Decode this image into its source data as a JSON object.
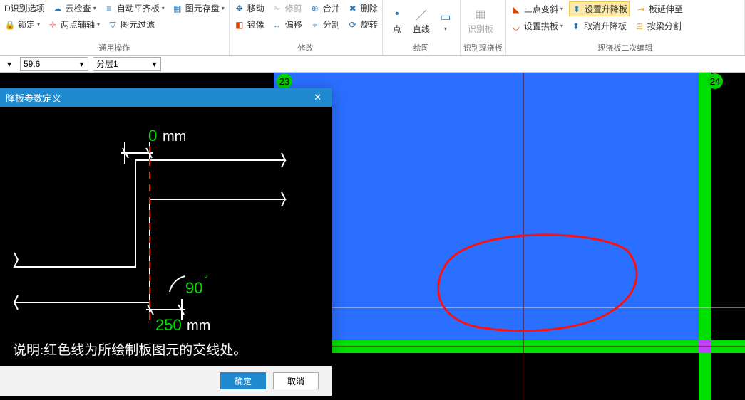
{
  "ribbon": {
    "groups": [
      {
        "label": "通用操作",
        "items_row1": [
          {
            "label": "D识别选项",
            "icon": "⚙"
          },
          {
            "label": "云检查",
            "icon": "☁"
          },
          {
            "label": "自动平齐板",
            "icon": "≡"
          },
          {
            "label": "图元存盘",
            "icon": "💾"
          }
        ],
        "items_row2": [
          {
            "label": "锁定",
            "icon": "🔒"
          },
          {
            "label": "两点辅轴",
            "icon": "✛"
          },
          {
            "label": "图元过滤",
            "icon": "▽"
          }
        ]
      },
      {
        "label": "修改",
        "items_row1": [
          {
            "label": "移动",
            "icon": "✥"
          },
          {
            "label": "修剪",
            "icon": "✁"
          },
          {
            "label": "合并",
            "icon": "⊕"
          },
          {
            "label": "删除",
            "icon": "✖"
          }
        ],
        "items_row2": [
          {
            "label": "镜像",
            "icon": "◧"
          },
          {
            "label": "偏移",
            "icon": "↔"
          },
          {
            "label": "分割",
            "icon": "÷"
          },
          {
            "label": "旋转",
            "icon": "⟳"
          }
        ]
      },
      {
        "label": "绘图",
        "big_items": [
          {
            "label": "点",
            "icon": "•"
          },
          {
            "label": "直线",
            "icon": "／"
          },
          {
            "label": "",
            "icon": "▭"
          }
        ]
      },
      {
        "label": "识别现浇板",
        "big_items": [
          {
            "label": "识别板",
            "icon": "▦"
          }
        ]
      },
      {
        "label": "现浇板二次编辑",
        "items_row1": [
          {
            "label": "三点变斜",
            "icon": "◣"
          },
          {
            "label": "设置升降板",
            "icon": "⬍",
            "hl": true
          },
          {
            "label": "板延伸至",
            "icon": "⇥"
          }
        ],
        "items_row2": [
          {
            "label": "设置拱板",
            "icon": "◡"
          },
          {
            "label": "取消升降板",
            "icon": "⬍"
          },
          {
            "label": "按梁分割",
            "icon": "⊟"
          }
        ]
      }
    ]
  },
  "secondary": {
    "value1": "59.6",
    "value2": "分层1"
  },
  "canvas": {
    "marker1": "23",
    "marker2": "24"
  },
  "dialog": {
    "title": "降板参数定义",
    "offset_value": "0",
    "offset_unit": "mm",
    "angle": "90",
    "angle_unit": "°",
    "width_value": "250",
    "width_unit": "mm",
    "note": "说明:红色线为所绘制板图元的交线处。",
    "ok": "确定",
    "cancel": "取消"
  }
}
